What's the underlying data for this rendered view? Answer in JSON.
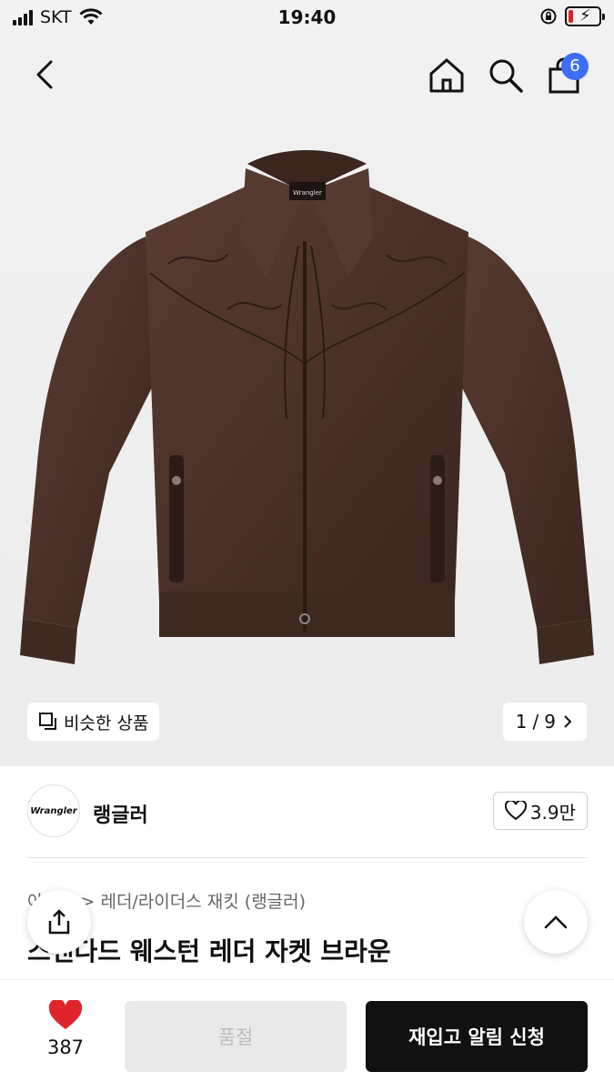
{
  "status_bar": {
    "carrier": "SKT",
    "time": "19:40"
  },
  "header": {
    "cart_count": "6"
  },
  "hero": {
    "similar_label": "비슷한 상품",
    "page_current": "1",
    "page_sep": "/",
    "page_total": "9",
    "jacket_label": "Wrangler"
  },
  "brand": {
    "logo_text": "Wrangler",
    "name": "랭글러",
    "likes": "3.9만"
  },
  "product": {
    "breadcrumb_prefix": "아우터",
    "breadcrumb_sep": ">",
    "breadcrumb_category": "레더/라이더스 재킷 (랭글러)",
    "title": "스탠다드 웨스턴 레더 자켓 브라운"
  },
  "bottom_bar": {
    "heart_count": "387",
    "soldout_label": "품절",
    "restock_label": "재입고 알림 신청"
  },
  "colors": {
    "accent": "#3d6ef5",
    "heart": "#e0242c",
    "jacket": "#4a3128"
  }
}
